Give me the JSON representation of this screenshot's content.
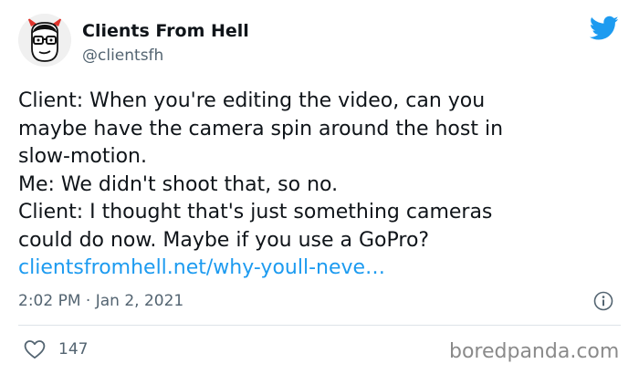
{
  "author": {
    "name": "Clients From Hell",
    "handle": "@clientsfh",
    "avatar_icon": "devil-man-with-glasses-avatar"
  },
  "platform_icon": "twitter-bird-icon",
  "tweet": {
    "lines": [
      "Client: When you're editing the video, can you",
      "maybe have the camera spin around the host in",
      "slow-motion.",
      "Me: We didn't shoot that, so no.",
      "Client: I thought that's just something cameras",
      "could do now. Maybe if you use a GoPro?"
    ],
    "link": "clientsfromhell.net/why-youll-neve…",
    "timestamp": "2:02 PM · Jan 2, 2021"
  },
  "actions": {
    "like_count": "147",
    "like_icon": "heart-icon",
    "info_icon": "info-icon"
  },
  "watermark": "boredpanda.com",
  "colors": {
    "link": "#1d9bf0",
    "twitter_blue": "#1d9bf0",
    "secondary_text": "#536471",
    "devil_horns": "#e0342c"
  }
}
